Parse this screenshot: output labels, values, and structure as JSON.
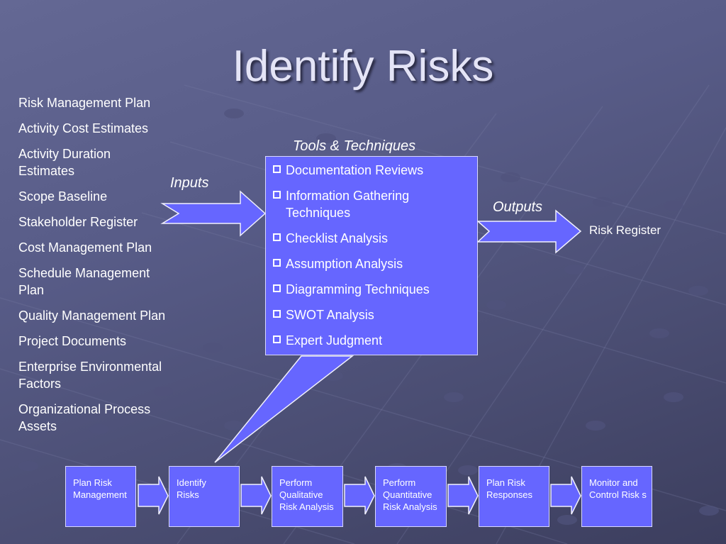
{
  "slide": {
    "title": "Identify Risks",
    "inputs_label": "Inputs",
    "tools_label": "Tools & Techniques",
    "outputs_label": "Outputs",
    "inputs": [
      "Risk Management Plan",
      "Activity Cost Estimates",
      "Activity Duration Estimates",
      "Scope Baseline",
      "Stakeholder Register",
      "Cost Management Plan",
      "Schedule Management Plan",
      "Quality Management Plan",
      "Project Documents",
      "Enterprise Environmental Factors",
      "Organizational Process Assets"
    ],
    "tools": [
      "Documentation Reviews",
      "Information Gathering Techniques",
      "Checklist Analysis",
      "Assumption Analysis",
      "Diagramming Techniques",
      "SWOT Analysis",
      "Expert Judgment"
    ],
    "outputs": [
      "Risk Register"
    ],
    "process_flow": [
      "Plan Risk Management",
      "Identify Risks",
      "Perform Qualitative Risk Analysis",
      "Perform Quantitative Risk Analysis",
      "Plan Risk Responses",
      "Monitor and Control Risk s"
    ]
  },
  "colors": {
    "shape_fill": "#6666ff",
    "text": "#ffffff"
  }
}
